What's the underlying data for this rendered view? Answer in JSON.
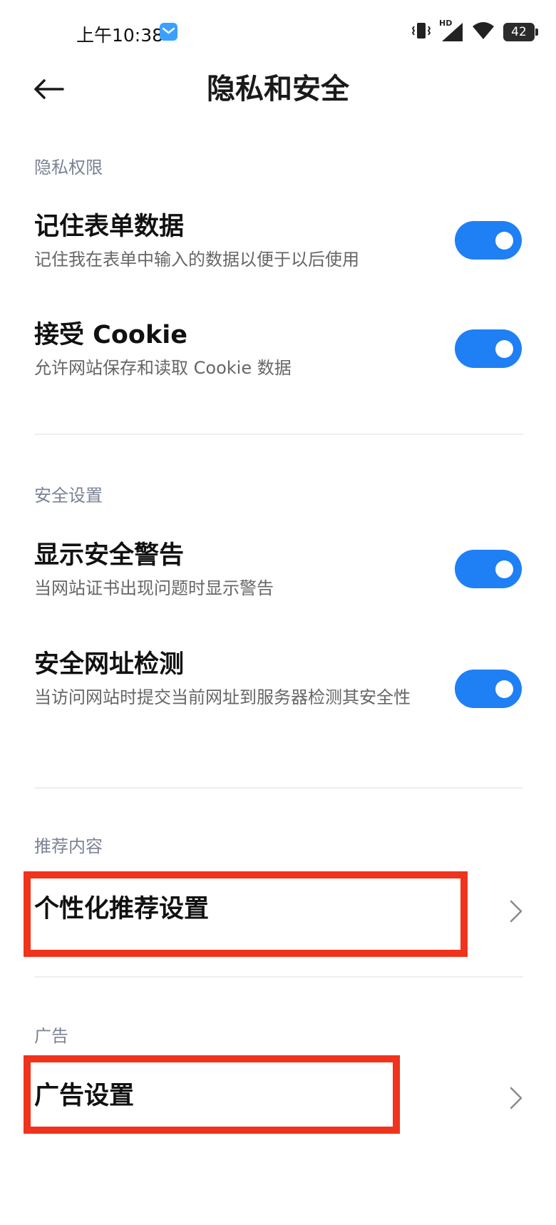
{
  "status_bar": {
    "time": "上午10:38",
    "hd_label": "HD",
    "battery_level": "42"
  },
  "header": {
    "title": "隐私和安全"
  },
  "sections": {
    "privacy": {
      "label": "隐私权限",
      "items": [
        {
          "title": "记住表单数据",
          "subtitle": "记住我在表单中输入的数据以便于以后使用",
          "enabled": true
        },
        {
          "title": "接受 Cookie",
          "subtitle": "允许网站保存和读取 Cookie 数据",
          "enabled": true
        }
      ]
    },
    "security": {
      "label": "安全设置",
      "items": [
        {
          "title": "显示安全警告",
          "subtitle": "当网站证书出现问题时显示警告",
          "enabled": true
        },
        {
          "title": "安全网址检测",
          "subtitle": "当访问网站时提交当前网址到服务器检测其安全性",
          "enabled": true
        }
      ]
    },
    "recommend": {
      "label": "推荐内容",
      "item_title": "个性化推荐设置"
    },
    "ads": {
      "label": "广告",
      "item_title": "广告设置"
    }
  },
  "colors": {
    "toggle_on": "#1f7ff5",
    "highlight": "#f0331c",
    "section_label": "#7b8294"
  }
}
